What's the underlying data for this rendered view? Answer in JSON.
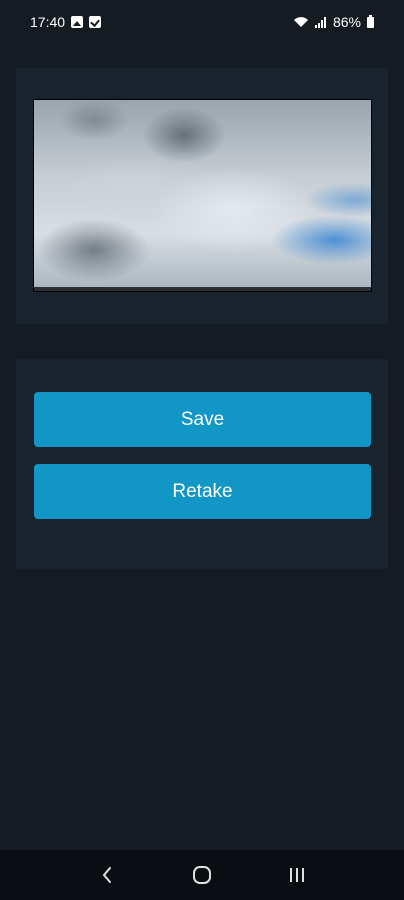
{
  "status_bar": {
    "time": "17:40",
    "battery": "86%",
    "icons": [
      "image-notification-icon",
      "check-notification-icon",
      "wifi-icon",
      "signal-icon",
      "battery-icon"
    ]
  },
  "preview": {
    "image": "cloudy-sky-photo"
  },
  "actions": {
    "save_label": "Save",
    "retake_label": "Retake"
  },
  "nav": {
    "icons": [
      "back-icon",
      "home-icon",
      "recents-icon"
    ]
  },
  "colors": {
    "background": "#141b22",
    "panel": "#18232d",
    "accent": "#1296c6",
    "nav_bar": "#0a0e12"
  }
}
